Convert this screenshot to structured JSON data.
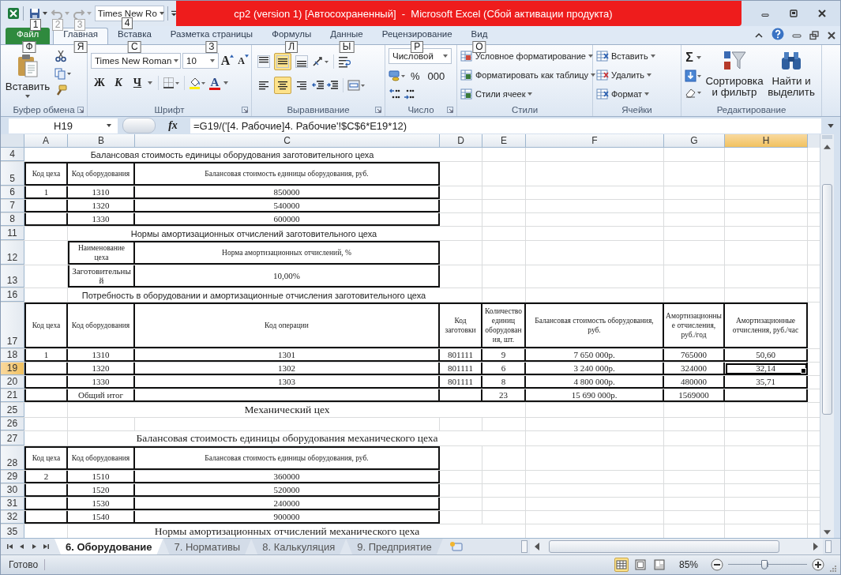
{
  "window": {
    "title": "cp2 (version 1) [Автосохраненный]  -  Microsoft Excel (Сбой активации продукта)",
    "quick_access": [
      {
        "kind": "save",
        "keytip": "1",
        "disabled": false
      },
      {
        "kind": "undo",
        "keytip": "2",
        "disabled": true
      },
      {
        "kind": "redo",
        "keytip": "3",
        "disabled": true
      }
    ],
    "font_box": {
      "value": "Times New Ro",
      "keytip": "4"
    }
  },
  "ribbon_tabs": [
    {
      "label": "Файл",
      "kind": "file",
      "keytip": "Ф",
      "selected": false
    },
    {
      "label": "Главная",
      "kind": "tab",
      "keytip": "Я",
      "selected": true
    },
    {
      "label": "Вставка",
      "kind": "tab",
      "keytip": "С",
      "selected": false
    },
    {
      "label": "Разметка страницы",
      "kind": "tab",
      "keytip": "З",
      "selected": false
    },
    {
      "label": "Формулы",
      "kind": "tab",
      "keytip": "Л",
      "selected": false
    },
    {
      "label": "Данные",
      "kind": "tab",
      "keytip": "Ы",
      "selected": false
    },
    {
      "label": "Рецензирование",
      "kind": "tab",
      "keytip": "Р",
      "selected": false
    },
    {
      "label": "Вид",
      "kind": "tab",
      "keytip": "О",
      "selected": false
    }
  ],
  "ribbon_groups": [
    {
      "kind": "clipboard",
      "label": "Буфер обмена",
      "launcher": true,
      "paste": "Вставить"
    },
    {
      "kind": "font",
      "label": "Шрифт",
      "launcher": true,
      "font_name": "Times New Roman",
      "font_size": "10",
      "grow": "A",
      "shrink": "A",
      "bold": "Ж",
      "italic": "К",
      "underline": "Ч",
      "font_color": "A"
    },
    {
      "kind": "alignment",
      "label": "Выравнивание",
      "launcher": true,
      "vertical": [
        {
          "kind": "top",
          "selected": false
        },
        {
          "kind": "middle",
          "selected": true
        },
        {
          "kind": "bottom",
          "selected": false
        }
      ],
      "horizontal": [
        {
          "kind": "left",
          "selected": false
        },
        {
          "kind": "center",
          "selected": true
        },
        {
          "kind": "right",
          "selected": false
        }
      ]
    },
    {
      "kind": "number",
      "label": "Число",
      "launcher": true,
      "format": "Числовой",
      "percent": "%",
      "thousands": "000"
    },
    {
      "kind": "styles",
      "label": "Стили",
      "launcher": false,
      "items": [
        "Условное форматирование",
        "Форматировать как таблицу",
        "Стили ячеек"
      ]
    },
    {
      "kind": "cells",
      "label": "Ячейки",
      "launcher": false,
      "items": [
        "Вставить",
        "Удалить",
        "Формат"
      ]
    },
    {
      "kind": "editing",
      "label": "Редактирование",
      "launcher": false,
      "sum": "Σ",
      "sort": "Сортировка и фильтр",
      "find": "Найти и выделить"
    }
  ],
  "formula_bar": {
    "name_box": "H19",
    "function_label": "fx",
    "formula": "=G19/('[4. Рабочие]4. Рабочие'!$C$6*E19*12)"
  },
  "columns": [
    {
      "label": "A",
      "selected": false
    },
    {
      "label": "B",
      "selected": false
    },
    {
      "label": "C",
      "selected": false
    },
    {
      "label": "D",
      "selected": false
    },
    {
      "label": "E",
      "selected": false
    },
    {
      "label": "F",
      "selected": false
    },
    {
      "label": "G",
      "selected": false
    },
    {
      "label": "H",
      "selected": true
    }
  ],
  "rows": [
    {
      "n": "4",
      "kind": "title-ac",
      "selected": false,
      "cells": [
        "Балансовая стоимость единицы оборудования заготовительного цеха"
      ]
    },
    {
      "n": "5",
      "kind": "table-ac",
      "selected": false,
      "header": true,
      "cells": [
        "Код цеха",
        "Код оборудования",
        "Балансовая стоимость единицы оборудования, руб."
      ]
    },
    {
      "n": "6",
      "kind": "table-ac",
      "selected": false,
      "header": false,
      "cells": [
        "1",
        "1310",
        "850000"
      ]
    },
    {
      "n": "7",
      "kind": "table-ac",
      "selected": false,
      "header": false,
      "cells": [
        null,
        "1320",
        "540000"
      ]
    },
    {
      "n": "8",
      "kind": "table-ac",
      "selected": false,
      "header": false,
      "cells": [
        null,
        "1330",
        "600000"
      ]
    },
    {
      "n": "11",
      "kind": "title-bc",
      "selected": false,
      "cells": [
        "Нормы амортизационных отчислений заготовительного цеха"
      ]
    },
    {
      "n": "12",
      "kind": "table-bc",
      "selected": false,
      "header": true,
      "cells": [
        "Наименование цеха",
        "Норма амортизационных отчислений, %"
      ]
    },
    {
      "n": "13",
      "kind": "table-bc",
      "selected": false,
      "header": false,
      "cells": [
        "Заготовительный",
        "10,00%"
      ]
    },
    {
      "n": "16",
      "kind": "title-bc",
      "selected": false,
      "cells": [
        "Потребность в оборудовании и амортизационные отчисления заготовительного цеха"
      ]
    },
    {
      "n": "17",
      "kind": "table-ah",
      "selected": false,
      "header": true,
      "cells": [
        "Код цеха",
        "Код оборудования",
        "Код операции",
        "Код заготовки",
        "Количество единиц оборудования, шт.",
        "Балансовая стоимость оборудования, руб.",
        "Амортизационные отчисления, руб./год",
        "Амортизационные отчисления, руб./час"
      ]
    },
    {
      "n": "18",
      "kind": "table-ah",
      "selected": false,
      "header": false,
      "cells": [
        "1",
        "1310",
        "1301",
        "801111",
        "9",
        "7 650 000р.",
        "765000",
        "50,60"
      ]
    },
    {
      "n": "19",
      "kind": "table-ah",
      "selected": true,
      "header": false,
      "cells": [
        null,
        "1320",
        "1302",
        "801111",
        "6",
        "3 240 000р.",
        "324000",
        "32,14"
      ]
    },
    {
      "n": "20",
      "kind": "table-ah",
      "selected": false,
      "header": false,
      "cells": [
        null,
        "1330",
        "1303",
        "801111",
        "8",
        "4 800 000р.",
        "480000",
        "35,71"
      ]
    },
    {
      "n": "21",
      "kind": "table-ah",
      "selected": false,
      "header": false,
      "cells": [
        null,
        "Общий итог",
        null,
        null,
        "23",
        "15 690 000р.",
        "1569000",
        null
      ]
    },
    {
      "n": "25",
      "kind": "heading",
      "selected": false,
      "cells": [
        "Механический цех"
      ]
    },
    {
      "n": "26",
      "kind": "blank",
      "selected": false,
      "cells": []
    },
    {
      "n": "27",
      "kind": "heading",
      "selected": false,
      "cells": [
        "Балансовая стоимость единицы оборудования механического цеха"
      ]
    },
    {
      "n": "28",
      "kind": "table-ac",
      "selected": false,
      "header": true,
      "cells": [
        "Код цеха",
        "Код оборудования",
        "Балансовая стоимость единицы оборудования, руб."
      ]
    },
    {
      "n": "29",
      "kind": "table-ac",
      "selected": false,
      "header": false,
      "cells": [
        "2",
        "1510",
        "360000"
      ]
    },
    {
      "n": "30",
      "kind": "table-ac",
      "selected": false,
      "header": false,
      "cells": [
        null,
        "1520",
        "520000"
      ]
    },
    {
      "n": "31",
      "kind": "table-ac",
      "selected": false,
      "header": false,
      "cells": [
        null,
        "1530",
        "240000"
      ]
    },
    {
      "n": "32",
      "kind": "table-ac",
      "selected": false,
      "header": false,
      "cells": [
        null,
        "1540",
        "900000"
      ]
    },
    {
      "n": "35",
      "kind": "heading",
      "selected": false,
      "cells": [
        "Нормы амортизационных отчислений механического цеха"
      ]
    }
  ],
  "sheet_tabs": [
    {
      "label": "6. Оборудование",
      "selected": true
    },
    {
      "label": "7. Нормативы",
      "selected": false
    },
    {
      "label": "8. Калькуляция",
      "selected": false
    },
    {
      "label": "9. Предприятие",
      "selected": false
    }
  ],
  "status_bar": {
    "text": "Готово",
    "views": [
      {
        "kind": "normal",
        "selected": true
      },
      {
        "kind": "page_layout",
        "selected": false
      },
      {
        "kind": "page_break",
        "selected": false
      }
    ],
    "zoom": "85%",
    "zoom_slider": {
      "level": 0.46
    }
  }
}
